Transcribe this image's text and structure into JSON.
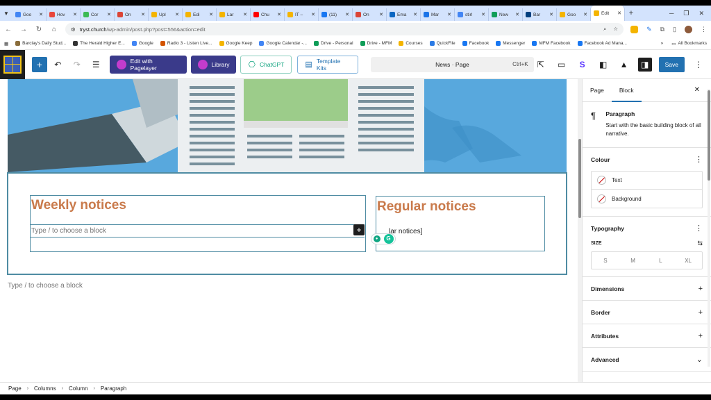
{
  "browser": {
    "tabs": [
      {
        "label": "Goo",
        "color": "#4285f4"
      },
      {
        "label": "Hov",
        "color": "#e8453c"
      },
      {
        "label": "Cor",
        "color": "#3cba54"
      },
      {
        "label": "On",
        "color": "#db4437"
      },
      {
        "label": "Upl",
        "color": "#f4b400"
      },
      {
        "label": "Edi",
        "color": "#f4b400"
      },
      {
        "label": "Lar",
        "color": "#f4b400"
      },
      {
        "label": "Chu",
        "color": "#ff0000"
      },
      {
        "label": "IT –",
        "color": "#f4b400"
      },
      {
        "label": "(11)",
        "color": "#1877f2"
      },
      {
        "label": "On",
        "color": "#db4437"
      },
      {
        "label": "Ema",
        "color": "#0a66c2"
      },
      {
        "label": "Mar",
        "color": "#1a73e8"
      },
      {
        "label": "stirl",
        "color": "#4285f4"
      },
      {
        "label": "New",
        "color": "#0f9d58"
      },
      {
        "label": "Bar",
        "color": "#003f7f"
      },
      {
        "label": "Goo",
        "color": "#f4b400"
      },
      {
        "label": "Edit",
        "color": "#f4b400",
        "active": true
      }
    ],
    "url_host": "tryst.church",
    "url_path": "/wp-admin/post.php?post=556&action=edit",
    "bookmarks": [
      {
        "label": "Barclay's Daily Stud...",
        "color": "#8a6d3b"
      },
      {
        "label": "The Herald Higher E...",
        "color": "#333333"
      },
      {
        "label": "Google",
        "color": "#4285f4"
      },
      {
        "label": "Radio 3 - Listen Live...",
        "color": "#d35400"
      },
      {
        "label": "Google Keep",
        "color": "#f4b400"
      },
      {
        "label": "Google Calendar -...",
        "color": "#4285f4"
      },
      {
        "label": "Drive - Personal",
        "color": "#0f9d58"
      },
      {
        "label": "Drive - MFM",
        "color": "#0f9d58"
      },
      {
        "label": "Courses",
        "color": "#f4b400"
      },
      {
        "label": "QuickFile",
        "color": "#2c7be5"
      },
      {
        "label": "Facebook",
        "color": "#1877f2"
      },
      {
        "label": "Messenger",
        "color": "#1877f2"
      },
      {
        "label": "MFM Facebook",
        "color": "#1877f2"
      },
      {
        "label": "Facebook Ad Mana...",
        "color": "#1877f2"
      }
    ],
    "all_bookmarks": "All Bookmarks"
  },
  "toolbar": {
    "pagelayer_label": "Edit with Pagelayer",
    "library_label": "Library",
    "chatgpt_label": "ChatGPT",
    "template_kits_label": "Template Kits",
    "doc_title": "News · Page",
    "shortcut": "Ctrl+K",
    "save_label": "Save"
  },
  "editor": {
    "left_heading": "Weekly notices",
    "paragraph_placeholder": "Type / to choose a block",
    "right_heading": "Regular notices",
    "right_shortcode": "lar notices]",
    "below_placeholder": "Type / to choose a block"
  },
  "sidebar": {
    "tab_page": "Page",
    "tab_block": "Block",
    "block_title": "Paragraph",
    "block_desc": "Start with the basic building block of all narrative.",
    "colour_title": "Colour",
    "colour_text": "Text",
    "colour_background": "Background",
    "typography_title": "Typography",
    "size_label": "SIZE",
    "sizes": [
      "S",
      "M",
      "L",
      "XL"
    ],
    "dimensions_title": "Dimensions",
    "border_title": "Border",
    "attributes_title": "Attributes",
    "advanced_title": "Advanced"
  },
  "breadcrumb": [
    "Page",
    "Columns",
    "Column",
    "Paragraph"
  ]
}
